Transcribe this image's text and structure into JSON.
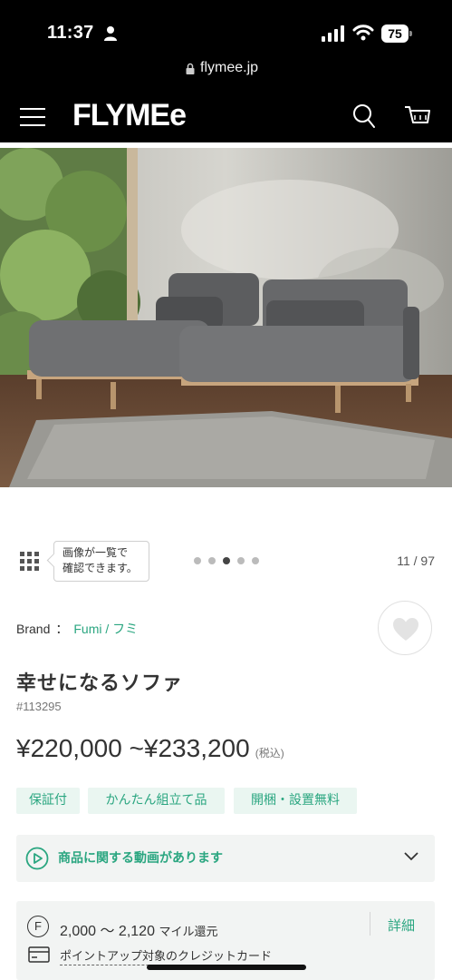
{
  "status_bar": {
    "time": "11:37",
    "battery": "75",
    "icons": [
      "person-icon",
      "signal-icon",
      "wifi-icon",
      "battery-icon"
    ]
  },
  "url_bar": {
    "url": "flymee.jp",
    "icon": "lock-icon"
  },
  "header": {
    "logo": "FLYMEe",
    "icons": [
      "menu-icon",
      "search-icon",
      "cart-icon"
    ]
  },
  "gallery": {
    "tooltip_line1": "画像が一覧で",
    "tooltip_line2": "確認できます。",
    "dot_count": 5,
    "active_dot": 3,
    "counter": "11 / 97"
  },
  "product": {
    "brand_label": "Brand",
    "brand_separator": "：",
    "brand_name": "Fumi / フミ",
    "title": "幸せになるソファ",
    "sku": "#113295",
    "price": "¥220,000 ~¥233,200",
    "tax_note": "(税込)",
    "tags": [
      "保証付",
      "かんたん組立て品",
      "開梱・設置無料"
    ]
  },
  "video": {
    "label": "商品に関する動画があります",
    "icons": [
      "play-circle-icon",
      "chevron-down-icon"
    ]
  },
  "miles": {
    "badge": "F",
    "amount": "2,000 ～ 2,120",
    "unit": "マイル還元",
    "details_label": "詳細",
    "card_text": "ポイントアップ対象のクレジットカード"
  },
  "colors": {
    "accent": "#2aa680",
    "tag_bg": "#eaf6f1",
    "panel_bg": "#f2f4f3",
    "header_bg": "#000000"
  }
}
